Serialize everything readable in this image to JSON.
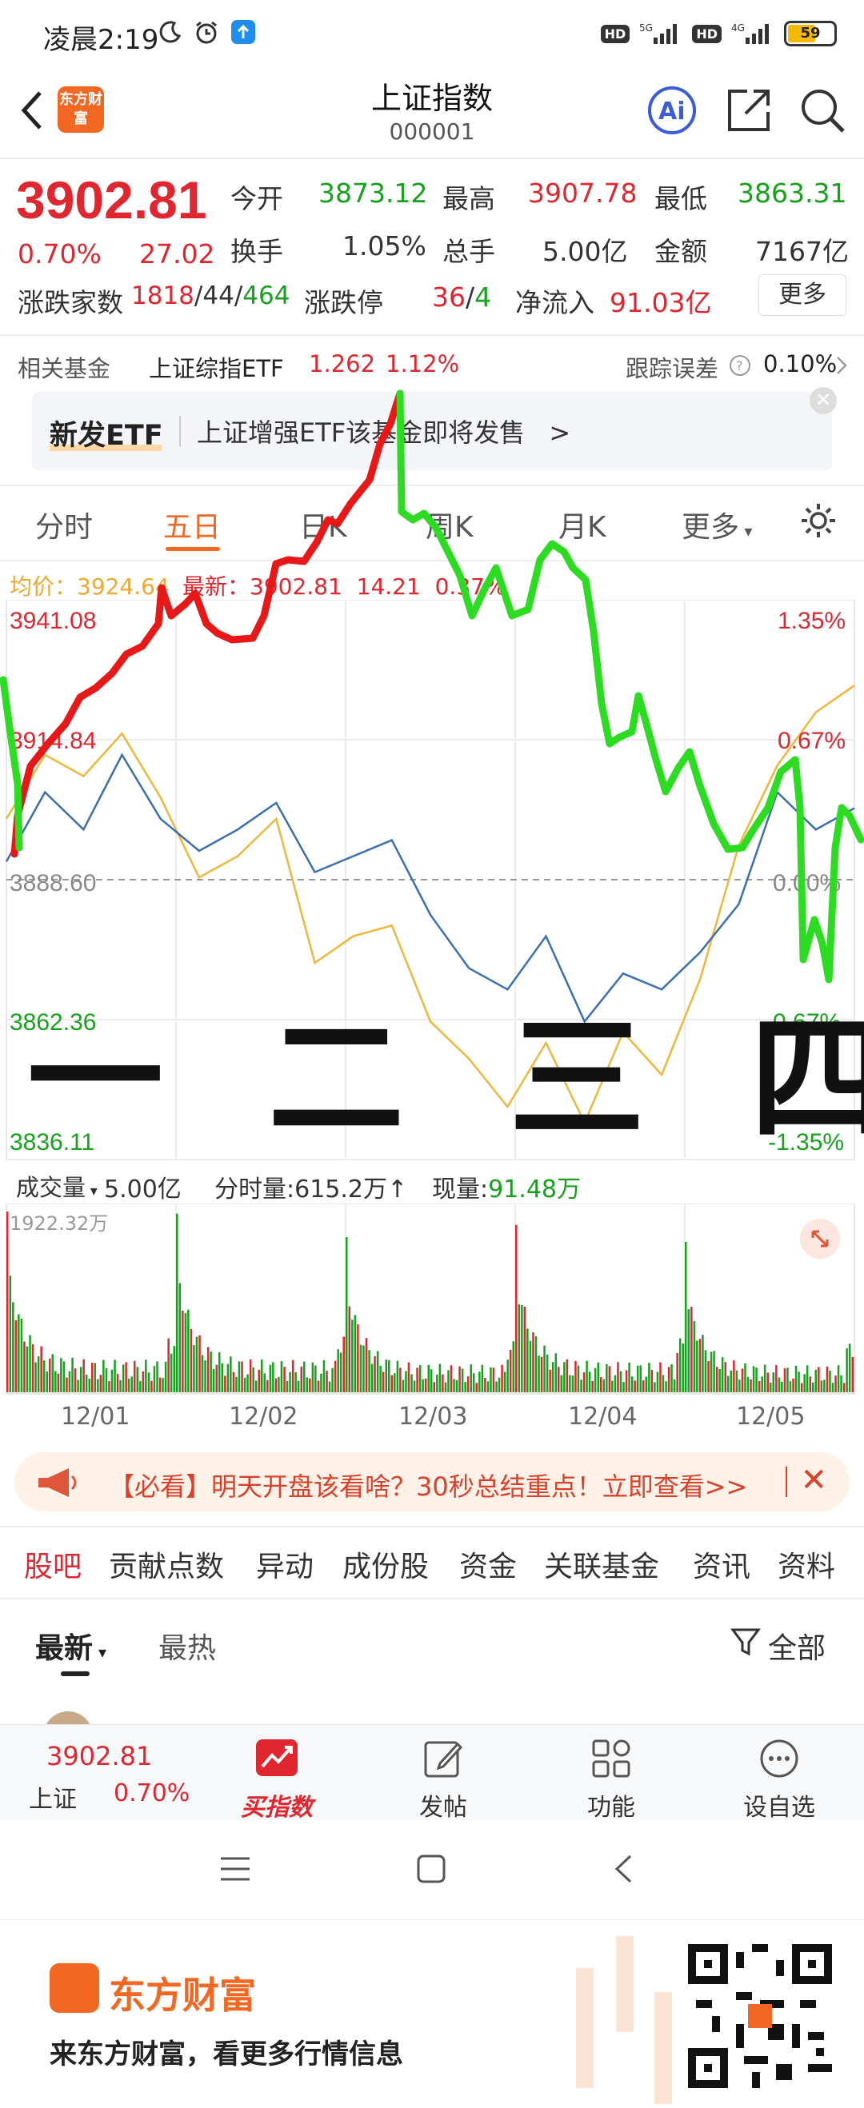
{
  "status_bar": {
    "time": "凌晨2:19",
    "network_5g": "5G",
    "network_4g": "4G",
    "battery": "59"
  },
  "header": {
    "logo_text": "东方财富",
    "title": "上证指数",
    "code": "000001"
  },
  "quote": {
    "price": "3902.81",
    "change_pct": "0.70%",
    "change": "27.02",
    "open_label": "今开",
    "open": "3873.12",
    "high_label": "最高",
    "high": "3907.78",
    "low_label": "最低",
    "low": "3863.31",
    "turnover_label": "换手",
    "turnover": "1.05%",
    "volume_label": "总手",
    "volume": "5.00亿",
    "amount_label": "金额",
    "amount": "7167亿",
    "breadth_label": "涨跌家数",
    "breadth_up": "1818",
    "breadth_flat": "44",
    "breadth_down": "464",
    "limit_label": "涨跌停",
    "limit_up": "36",
    "limit_down": "4",
    "inflow_label": "净流入",
    "inflow": "91.03亿",
    "more_label": "更多"
  },
  "fund": {
    "label": "相关基金",
    "name": "上证综指ETF",
    "price": "1.262",
    "pct": "1.12%",
    "track_label": "跟踪误差",
    "track_value": "0.10%"
  },
  "etf_banner": {
    "tag": "新发ETF",
    "message": "上证增强ETF该基金即将发售",
    "arrow": ">"
  },
  "chart_tabs": [
    "分时",
    "五日",
    "日K",
    "周K",
    "月K",
    "更多"
  ],
  "active_tab": "五日",
  "avg_line": {
    "avg_label": "均价：",
    "avg": "3924.64",
    "latest_label": "最新：",
    "latest": "3902.81",
    "change": "14.21",
    "pct": "0.37%"
  },
  "y_axis_left": [
    "3941.08",
    "3914.84",
    "3888.60",
    "3862.36",
    "3836.11"
  ],
  "y_axis_right": [
    "1.35%",
    "0.67%",
    "0.00%",
    "-0.67%",
    "-1.35%"
  ],
  "overlay_text": "一 二 三 四 五",
  "volume_panel": {
    "selector": "成交量",
    "total": "5.00亿",
    "minute_label": "分时量:",
    "minute": "615.2万",
    "minute_arrow": "↑",
    "now_label": "现量:",
    "now": "91.48万",
    "max": "1922.32万"
  },
  "chart_data": [
    {
      "type": "line",
      "title": "",
      "x": [
        "12/01",
        "12/02",
        "12/03",
        "12/04",
        "12/05"
      ],
      "ylim": [
        3836.11,
        3941.08
      ],
      "series": [
        {
          "name": "",
          "values": [
            3892,
            3905,
            3898,
            3912,
            3900,
            3894,
            3898,
            3903,
            3890,
            3893,
            3896,
            3882,
            3872,
            3868,
            3878,
            3862,
            3871,
            3868,
            3875,
            3884,
            3905,
            3898,
            3902
          ]
        },
        {
          "name": "",
          "values": [
            3900,
            3912,
            3908,
            3916,
            3904,
            3889,
            3893,
            3900,
            3873,
            3878,
            3880,
            3862,
            3855,
            3846,
            3858,
            3843,
            3860,
            3852,
            3870,
            3895,
            3910,
            3920,
            3925
          ]
        }
      ]
    },
    {
      "type": "bar",
      "title": "",
      "x": [
        "12/01",
        "12/02",
        "12/03",
        "12/04",
        "12/05"
      ],
      "ylim": [
        0,
        1922.32
      ],
      "series": [
        {
          "name": "",
          "values": [
            1922.32,
            1900,
            1650,
            1780,
            1600
          ]
        }
      ]
    }
  ],
  "notice": {
    "text": "【必看】明天开盘该看啥？30秒总结重点！立即查看>>",
    "close": "✕"
  },
  "forum_tabs": [
    "股吧",
    "贡献点数",
    "异动",
    "成份股",
    "资金",
    "关联基金",
    "资讯",
    "资料"
  ],
  "sort": {
    "latest": "最新",
    "hot": "最热",
    "filter": "全部"
  },
  "action_bar": {
    "price": "3902.81",
    "name": "上证",
    "pct": "0.70%",
    "buy": "买指数",
    "post": "发帖",
    "func": "功能",
    "watch": "设自选"
  },
  "footer": {
    "brand": "东方财富",
    "slogan": "来东方财富，看更多行情信息"
  },
  "colors": {
    "up": "#e0262f",
    "down": "#16a21d",
    "accent": "#f26722",
    "price_line": "#3a6fb0",
    "avg_line": "#f0b73a"
  }
}
